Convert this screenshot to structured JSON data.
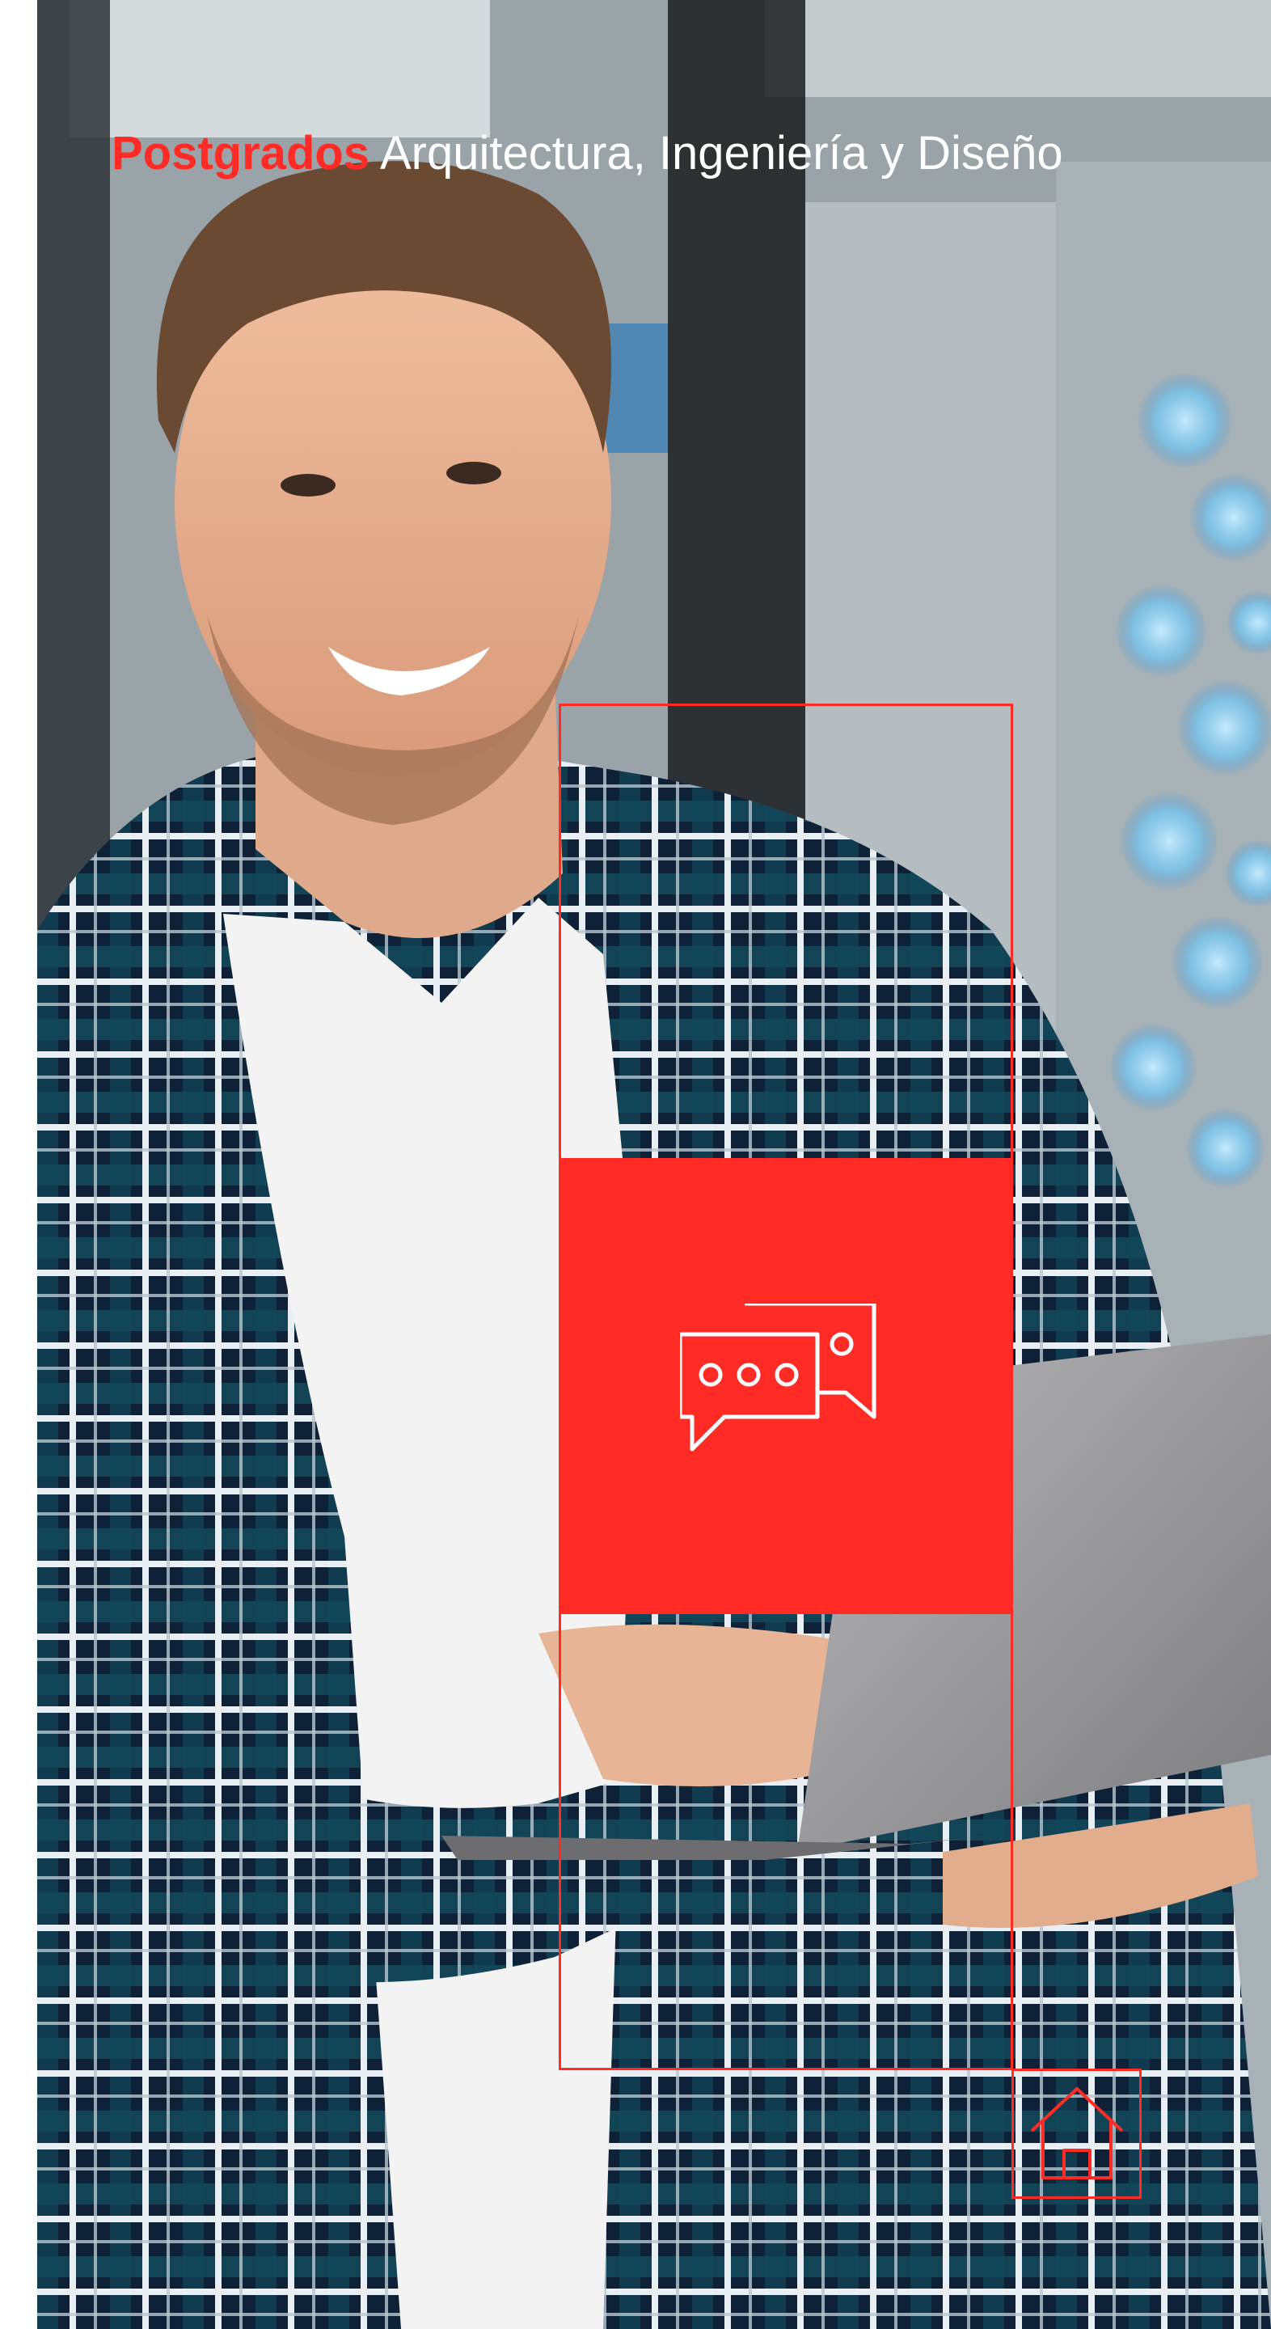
{
  "header": {
    "accent": "Postgrados",
    "title": " Arquitectura, Ingeniería y Diseño"
  },
  "icons": {
    "chat": "chat-bubbles-icon",
    "home": "home-icon"
  },
  "colors": {
    "accent": "#ff2b24",
    "text_light": "#ffffff"
  }
}
